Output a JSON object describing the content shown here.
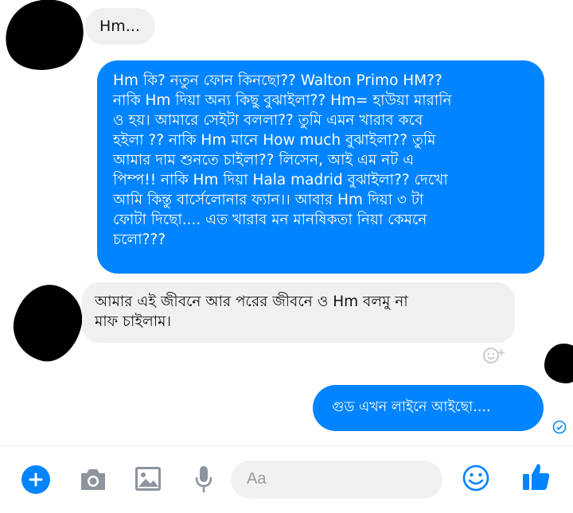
{
  "messages": [
    {
      "direction": "incoming",
      "text": "Hm..."
    },
    {
      "direction": "outgoing",
      "text": "Hm কি? নতুন ফোন কিনছো?? Walton Primo HM??\nনাকি Hm দিয়া অন্য কিছু বুঝাইলা?? Hm= হাউয়া মারানি\nও হয়। আমারে সেইটা বললা?? তুমি  এমন খারাব কবে\nহইলা ?? নাকি Hm মানে How much বুঝাইলা?? তুমি\nআমার দাম শুনতে চাইলা?? লিসেন, আই এম নট এ\nপিম্প!! নাকি Hm দিয়া Hala madrid বুঝাইলা?? দেখো\nআমি কিন্তু বার্সেলোনার ফ্যান।। আবার Hm দিয়া ৩ টা\nফোটা দিছো.... এত খারাব মন মানষিকতা নিয়া কেমনে\nচলো???"
    },
    {
      "direction": "incoming",
      "text": "আমার এই জীবনে আর পরের জীবনে ও Hm বলমু না\nমাফ চাইলাম।"
    },
    {
      "direction": "outgoing",
      "text": "গুড এখন লাইনে আইছো...."
    }
  ],
  "composer": {
    "placeholder": "Aa",
    "icons": [
      "plus-icon",
      "camera-icon",
      "image-icon",
      "mic-icon",
      "emoji-icon",
      "like-icon"
    ]
  },
  "colors": {
    "accent": "#0084ff",
    "incoming_bubble": "#f1f0f0",
    "outgoing_text": "#ffffff"
  }
}
